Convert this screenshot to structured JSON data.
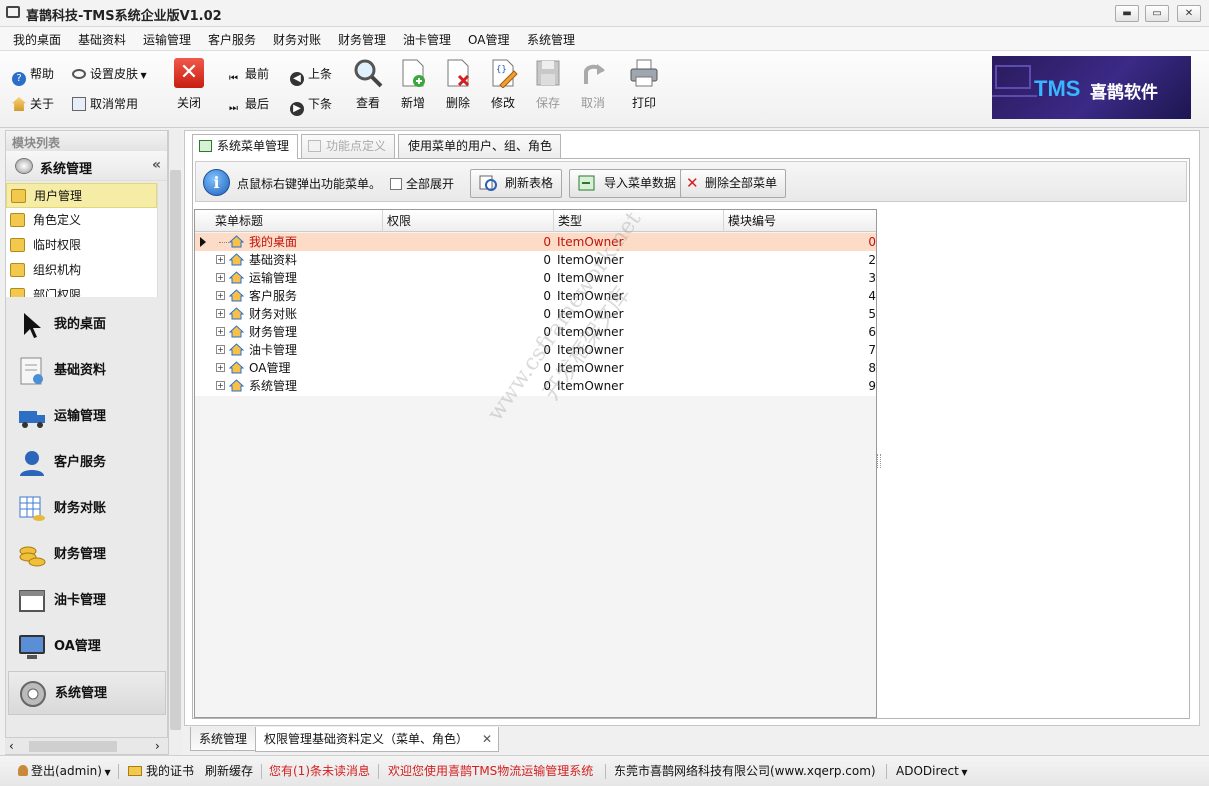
{
  "window": {
    "title": "喜鹊科技-TMS系统企业版V1.02",
    "min": "▬",
    "max": "▭",
    "close": "✕"
  },
  "menu": [
    "我的桌面",
    "基础资料",
    "运输管理",
    "客户服务",
    "财务对账",
    "财务管理",
    "油卡管理",
    "OA管理",
    "系统管理"
  ],
  "toolbar": {
    "help": "帮助",
    "skin": "设置皮肤",
    "about": "关于",
    "cancel_common": "取消常用",
    "close": "关闭",
    "first": "最前",
    "last": "最后",
    "prev": "上条",
    "next": "下条",
    "view": "查看",
    "add": "新增",
    "delete": "删除",
    "edit": "修改",
    "save": "保存",
    "cancel": "取消",
    "print": "打印"
  },
  "logo": {
    "tms": "TMS",
    "name": "喜鹊软件"
  },
  "sidebar": {
    "module_list": "模块列表",
    "system_header": "系统管理",
    "collapse": "«",
    "subitems": [
      "用户管理",
      "角色定义",
      "临时权限",
      "组织机构",
      "部门权限"
    ],
    "nav": [
      "我的桌面",
      "基础资料",
      "运输管理",
      "客户服务",
      "财务对账",
      "财务管理",
      "油卡管理",
      "OA管理",
      "系统管理"
    ]
  },
  "tabs": [
    "系统菜单管理",
    "功能点定义",
    "使用菜单的用户、组、角色"
  ],
  "info": {
    "text": "点鼠标右键弹出功能菜单。",
    "expand_all": "全部展开",
    "refresh": "刷新表格",
    "import": "导入菜单数据",
    "delete_all": "删除全部菜单"
  },
  "grid": {
    "columns": [
      "菜单标题",
      "权限",
      "类型",
      "模块编号"
    ],
    "rows": [
      {
        "title": "我的桌面",
        "perm": "0",
        "type": "ItemOwner",
        "id": "0"
      },
      {
        "title": "基础资料",
        "perm": "0",
        "type": "ItemOwner",
        "id": "2"
      },
      {
        "title": "运输管理",
        "perm": "0",
        "type": "ItemOwner",
        "id": "3"
      },
      {
        "title": "客户服务",
        "perm": "0",
        "type": "ItemOwner",
        "id": "4"
      },
      {
        "title": "财务对账",
        "perm": "0",
        "type": "ItemOwner",
        "id": "5"
      },
      {
        "title": "财务管理",
        "perm": "0",
        "type": "ItemOwner",
        "id": "6"
      },
      {
        "title": "油卡管理",
        "perm": "0",
        "type": "ItemOwner",
        "id": "7"
      },
      {
        "title": "OA管理",
        "perm": "0",
        "type": "ItemOwner",
        "id": "8"
      },
      {
        "title": "系统管理",
        "perm": "0",
        "type": "ItemOwner",
        "id": "9"
      }
    ]
  },
  "watermark": {
    "line1": "www.csframework.net",
    "line2": "开发框架文库"
  },
  "bottom_tabs": [
    "系统管理",
    "权限管理基础资料定义（菜单、角色）"
  ],
  "bottom_tab_close": "✕",
  "status": {
    "logout": "登出(admin)",
    "cert": "我的证书",
    "refresh_cache": "刷新缓存",
    "unread": "您有(1)条未读消息",
    "welcome": "欢迎您使用喜鹊TMS物流运输管理系统",
    "company": "东莞市喜鹊网络科技有限公司(www.xqerp.com)",
    "db": "ADODirect"
  },
  "colors": {
    "accent_red": "#d42020",
    "selection": "#fcdcc6",
    "sidebar_sel": "#f5eda6"
  }
}
